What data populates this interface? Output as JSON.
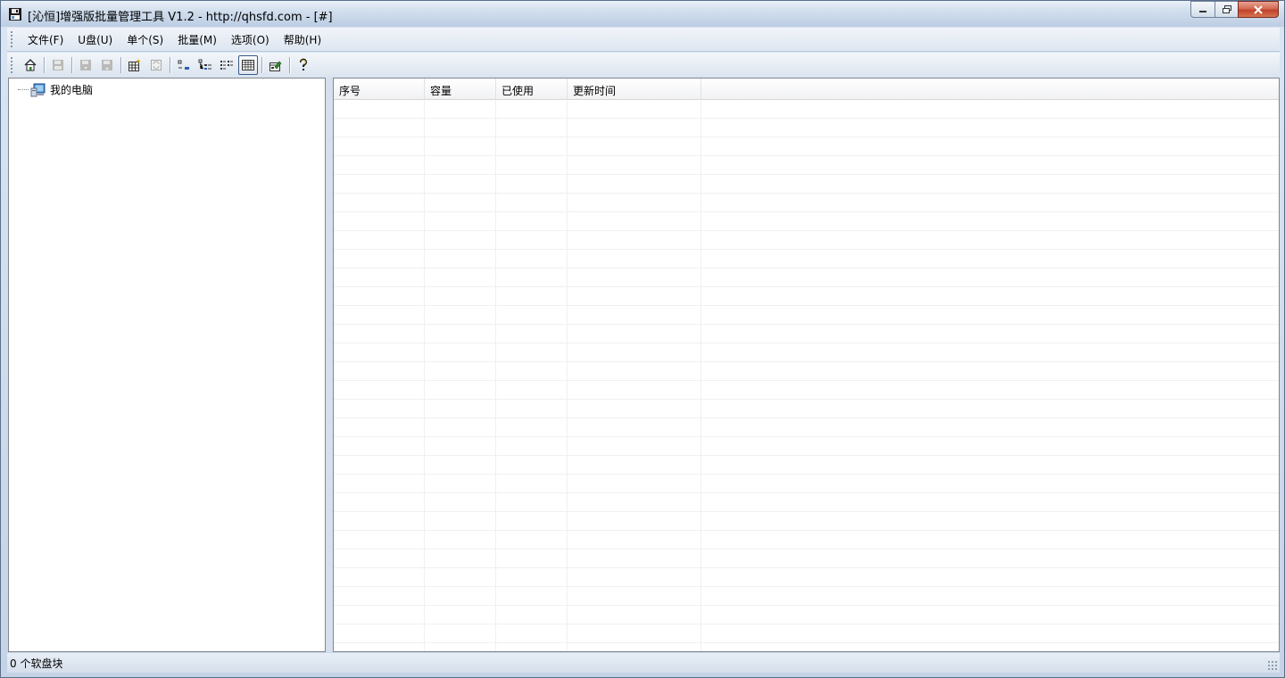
{
  "window": {
    "title": "[沁恒]增强版批量管理工具 V1.2 - http://qhsfd.com - [#]"
  },
  "menu": {
    "items": [
      {
        "label": "文件(F)"
      },
      {
        "label": "U盘(U)"
      },
      {
        "label": "单个(S)"
      },
      {
        "label": "批量(M)"
      },
      {
        "label": "选项(O)"
      },
      {
        "label": "帮助(H)"
      }
    ]
  },
  "toolbar": {
    "buttons": [
      {
        "icon": "home-icon"
      },
      {
        "icon": "save-disk-icon",
        "disabled": true
      },
      {
        "icon": "disk-write-icon",
        "disabled": true
      },
      {
        "icon": "disk-read-icon",
        "disabled": true
      },
      {
        "icon": "new-table-icon"
      },
      {
        "icon": "refresh-icon",
        "disabled": true
      },
      {
        "icon": "small-icons-view-icon"
      },
      {
        "icon": "tree-view-icon"
      },
      {
        "icon": "list-view-icon"
      },
      {
        "icon": "details-view-icon",
        "active": true
      },
      {
        "icon": "properties-icon"
      },
      {
        "icon": "help-icon"
      }
    ]
  },
  "tree": {
    "root": {
      "label": "我的电脑",
      "icon": "computer-icon"
    }
  },
  "list": {
    "columns": [
      {
        "label": "序号"
      },
      {
        "label": "容量"
      },
      {
        "label": "已使用"
      },
      {
        "label": "更新时间"
      }
    ],
    "rows": []
  },
  "status": {
    "text": "0 个软盘块"
  },
  "colors": {
    "frame": "#c8d6e8",
    "close_button": "#c0432b",
    "grid_line": "#f0f0f0"
  }
}
